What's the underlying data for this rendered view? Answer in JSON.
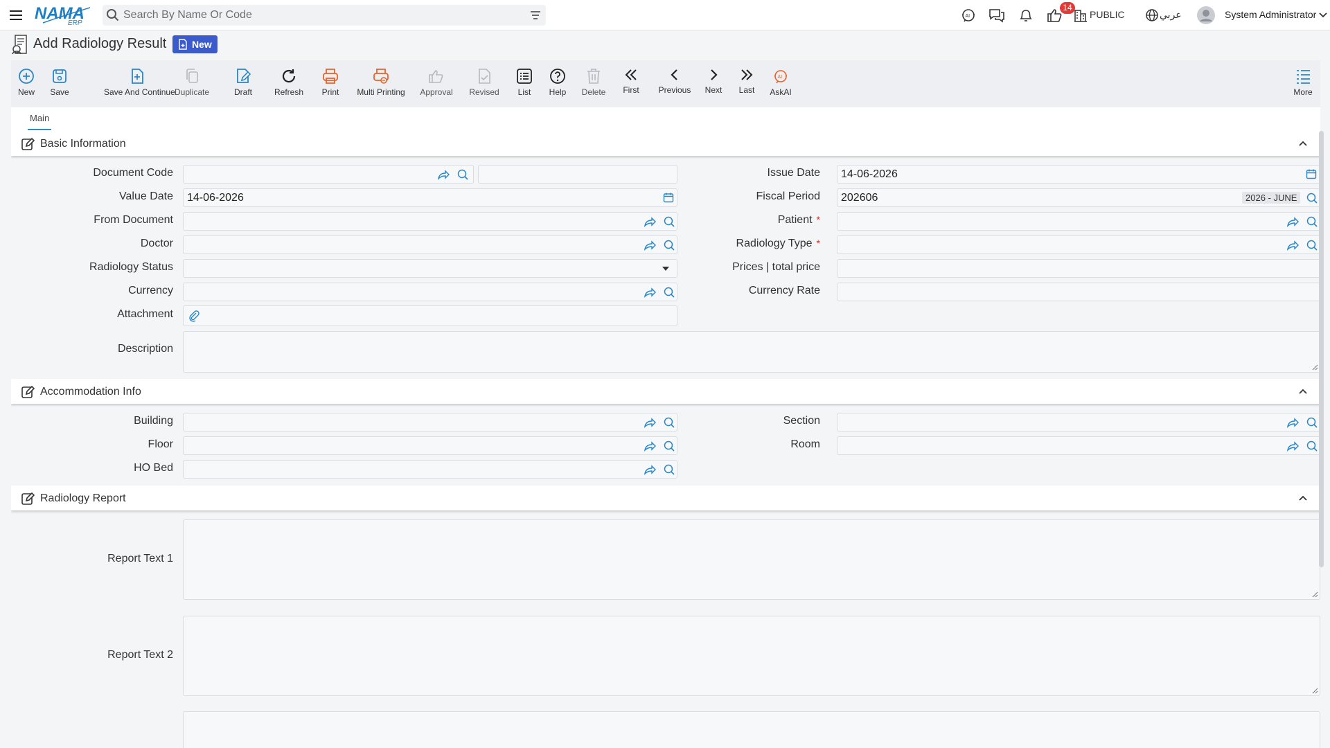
{
  "topbar": {
    "logo_text": "NAMA",
    "logo_sub": "ERP",
    "search_placeholder": "Search By Name Or Code",
    "notification_count": "14",
    "company_label": "PUBLIC",
    "language_label": "عربي",
    "user_name": "System Administrator",
    "icons": [
      "menu-icon",
      "search-icon",
      "filter-icon",
      "ai-support-icon",
      "chat-icon",
      "bell-icon",
      "thumbs-up-icon",
      "building-icon",
      "globe-icon",
      "user-avatar-icon",
      "chevron-down-icon"
    ]
  },
  "page": {
    "title": "Add Radiology Result",
    "status_badge": "New"
  },
  "toolbar": {
    "buttons": [
      {
        "label": "New",
        "icon": "plus-circle-icon"
      },
      {
        "label": "Save",
        "icon": "save-icon"
      },
      {
        "label": "Save And Continue",
        "icon": "save-continue-icon"
      },
      {
        "label": "Duplicate",
        "icon": "duplicate-icon"
      },
      {
        "label": "Draft",
        "icon": "draft-icon"
      },
      {
        "label": "Refresh",
        "icon": "refresh-icon"
      },
      {
        "label": "Print",
        "icon": "print-icon"
      },
      {
        "label": "Multi Printing",
        "icon": "multi-print-icon"
      },
      {
        "label": "Approval",
        "icon": "approval-icon"
      },
      {
        "label": "Revised",
        "icon": "revised-icon"
      },
      {
        "label": "List",
        "icon": "list-icon"
      },
      {
        "label": "Help",
        "icon": "help-icon"
      },
      {
        "label": "Delete",
        "icon": "delete-icon"
      },
      {
        "label": "First",
        "icon": "first-icon"
      },
      {
        "label": "Previous",
        "icon": "previous-icon"
      },
      {
        "label": "Next",
        "icon": "next-icon"
      },
      {
        "label": "Last",
        "icon": "last-icon"
      },
      {
        "label": "AskAI",
        "icon": "ask-ai-icon"
      },
      {
        "label": "More",
        "icon": "more-list-icon"
      }
    ],
    "colors": {
      "blue": "#2a86c8",
      "orange": "#e8622a",
      "dark": "#2b2b2b",
      "disabled": "#b5b8bd"
    }
  },
  "tabs": [
    {
      "label": "Main",
      "active": true
    }
  ],
  "sections": {
    "basic": {
      "title": "Basic Information",
      "document_code": {
        "label": "Document Code",
        "value": "",
        "secondary": ""
      },
      "issue_date": {
        "label": "Issue Date",
        "value": "14-06-2026"
      },
      "value_date": {
        "label": "Value Date",
        "value": "14-06-2026"
      },
      "fiscal_period": {
        "label": "Fiscal Period",
        "value": "202606",
        "tag": "2026 - JUNE"
      },
      "from_document": {
        "label": "From Document",
        "value": ""
      },
      "patient": {
        "label": "Patient",
        "value": "",
        "required_mark": "*"
      },
      "doctor": {
        "label": "Doctor",
        "value": ""
      },
      "radiology_type": {
        "label": "Radiology Type",
        "value": "",
        "required_mark": "*"
      },
      "radiology_status": {
        "label": "Radiology Status",
        "value": ""
      },
      "prices_total": {
        "label": "Prices | total price",
        "value": ""
      },
      "currency": {
        "label": "Currency",
        "value": ""
      },
      "currency_rate": {
        "label": "Currency Rate",
        "value": ""
      },
      "attachment": {
        "label": "Attachment"
      },
      "description": {
        "label": "Description",
        "value": ""
      }
    },
    "accommodation": {
      "title": "Accommodation Info",
      "building": {
        "label": "Building",
        "value": ""
      },
      "section": {
        "label": "Section",
        "value": ""
      },
      "floor": {
        "label": "Floor",
        "value": ""
      },
      "room": {
        "label": "Room",
        "value": ""
      },
      "ho_bed": {
        "label": "HO Bed",
        "value": ""
      }
    },
    "report": {
      "title": "Radiology Report",
      "text1": {
        "label": "Report Text 1",
        "value": ""
      },
      "text2": {
        "label": "Report Text 2",
        "value": ""
      }
    }
  }
}
